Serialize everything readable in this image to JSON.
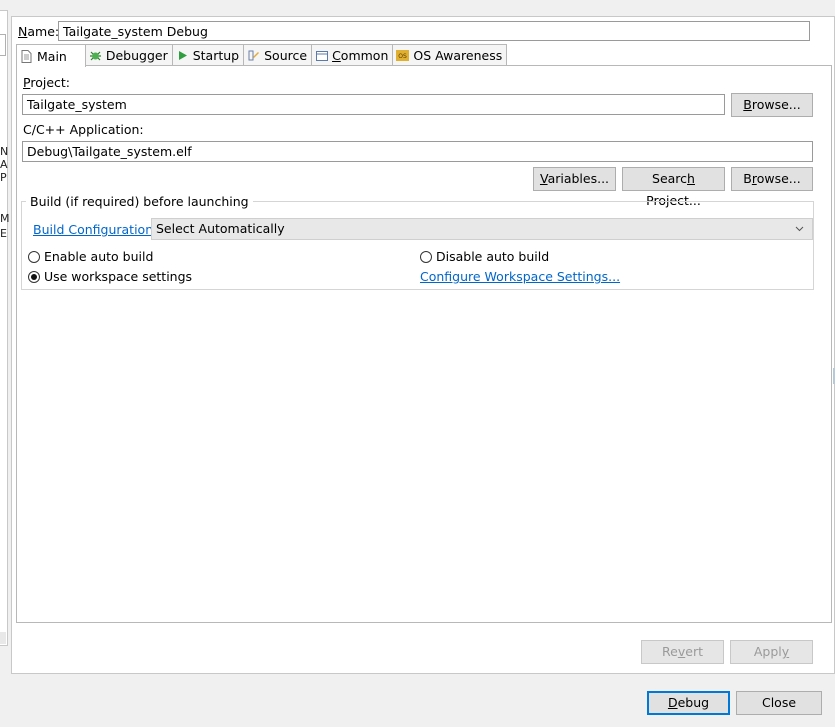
{
  "left_fragments": [
    "N",
    "A",
    "P",
    "M",
    "E"
  ],
  "name": {
    "label_underlined": "N",
    "label_rest": "ame:",
    "value": "Tailgate_system Debug"
  },
  "tabs": [
    {
      "label": "Main",
      "icon": "document-icon",
      "active": true
    },
    {
      "label": "Debugger",
      "icon": "bug-icon",
      "active": false
    },
    {
      "label": "Startup",
      "icon": "play-icon",
      "active": false
    },
    {
      "label": "Source",
      "icon": "source-icon",
      "active": false
    },
    {
      "label": "Common",
      "icon": "common-icon",
      "active": false
    },
    {
      "label": "OS Awareness",
      "icon": "os-icon",
      "active": false
    }
  ],
  "main": {
    "project_label": "Project:",
    "project_value": "Tailgate_system",
    "browse_label": "Browse...",
    "app_label": "C/C++ Application:",
    "app_value": "Debug\\Tailgate_system.elf",
    "variables_label": "Variables...",
    "search_project_label": "Search Project...",
    "browse2_label": "Browse...",
    "build_group_title": "Build (if required) before launching",
    "build_config_link": "Build Configuration:",
    "build_config_value": "Select Automatically",
    "enable_auto_build": "Enable auto build",
    "disable_auto_build": "Disable auto build",
    "use_workspace_settings": "Use workspace settings",
    "configure_workspace_link": "Configure Workspace Settings..."
  },
  "footer": {
    "revert_label": "Revert",
    "apply_label": "Apply",
    "debug_label": "Debug",
    "close_label": "Close"
  },
  "colors": {
    "link": "#0066cc",
    "focus": "#0078d7"
  }
}
